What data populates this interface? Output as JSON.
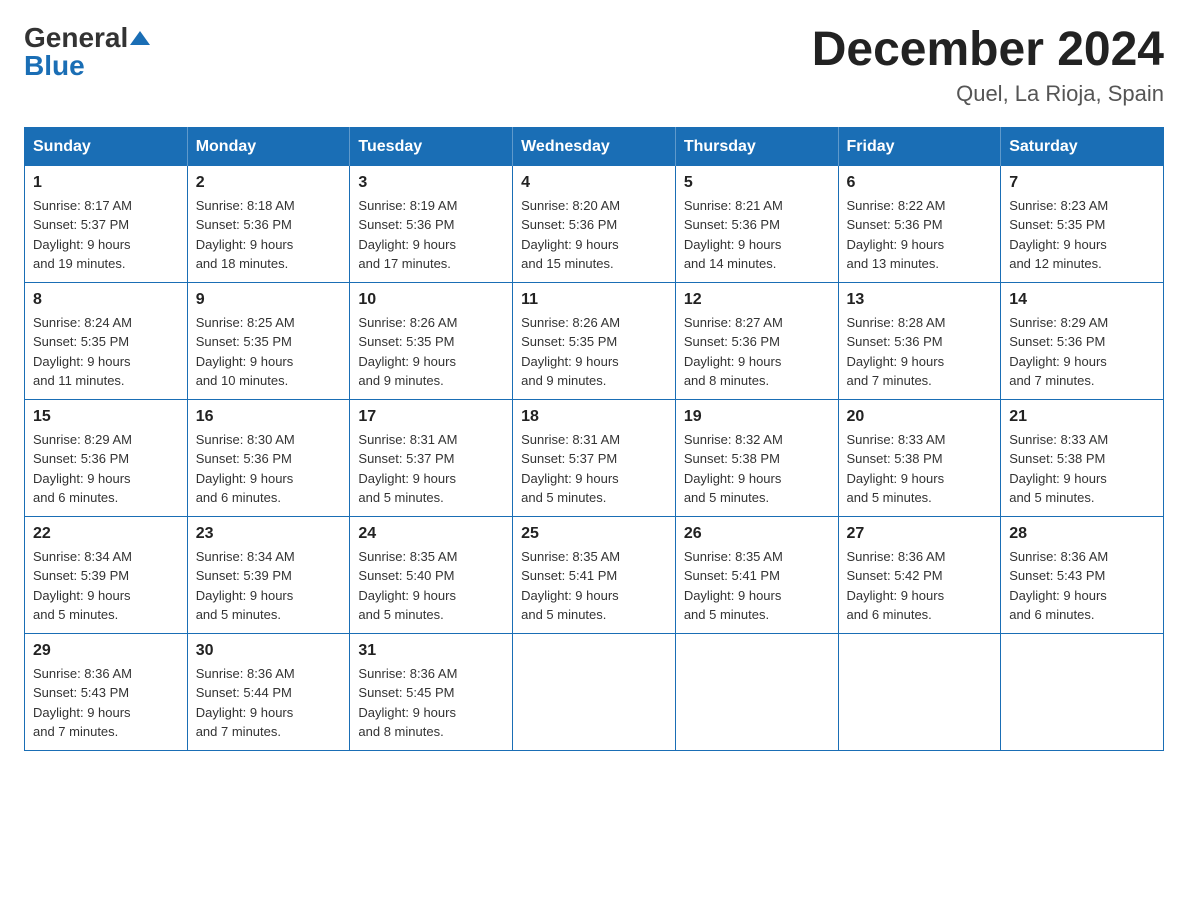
{
  "logo": {
    "general_text": "General",
    "blue_text": "Blue"
  },
  "title": {
    "month_year": "December 2024",
    "location": "Quel, La Rioja, Spain"
  },
  "days_of_week": [
    "Sunday",
    "Monday",
    "Tuesday",
    "Wednesday",
    "Thursday",
    "Friday",
    "Saturday"
  ],
  "weeks": [
    [
      {
        "day": "1",
        "sunrise": "8:17 AM",
        "sunset": "5:37 PM",
        "daylight": "9 hours and 19 minutes."
      },
      {
        "day": "2",
        "sunrise": "8:18 AM",
        "sunset": "5:36 PM",
        "daylight": "9 hours and 18 minutes."
      },
      {
        "day": "3",
        "sunrise": "8:19 AM",
        "sunset": "5:36 PM",
        "daylight": "9 hours and 17 minutes."
      },
      {
        "day": "4",
        "sunrise": "8:20 AM",
        "sunset": "5:36 PM",
        "daylight": "9 hours and 15 minutes."
      },
      {
        "day": "5",
        "sunrise": "8:21 AM",
        "sunset": "5:36 PM",
        "daylight": "9 hours and 14 minutes."
      },
      {
        "day": "6",
        "sunrise": "8:22 AM",
        "sunset": "5:36 PM",
        "daylight": "9 hours and 13 minutes."
      },
      {
        "day": "7",
        "sunrise": "8:23 AM",
        "sunset": "5:35 PM",
        "daylight": "9 hours and 12 minutes."
      }
    ],
    [
      {
        "day": "8",
        "sunrise": "8:24 AM",
        "sunset": "5:35 PM",
        "daylight": "9 hours and 11 minutes."
      },
      {
        "day": "9",
        "sunrise": "8:25 AM",
        "sunset": "5:35 PM",
        "daylight": "9 hours and 10 minutes."
      },
      {
        "day": "10",
        "sunrise": "8:26 AM",
        "sunset": "5:35 PM",
        "daylight": "9 hours and 9 minutes."
      },
      {
        "day": "11",
        "sunrise": "8:26 AM",
        "sunset": "5:35 PM",
        "daylight": "9 hours and 9 minutes."
      },
      {
        "day": "12",
        "sunrise": "8:27 AM",
        "sunset": "5:36 PM",
        "daylight": "9 hours and 8 minutes."
      },
      {
        "day": "13",
        "sunrise": "8:28 AM",
        "sunset": "5:36 PM",
        "daylight": "9 hours and 7 minutes."
      },
      {
        "day": "14",
        "sunrise": "8:29 AM",
        "sunset": "5:36 PM",
        "daylight": "9 hours and 7 minutes."
      }
    ],
    [
      {
        "day": "15",
        "sunrise": "8:29 AM",
        "sunset": "5:36 PM",
        "daylight": "9 hours and 6 minutes."
      },
      {
        "day": "16",
        "sunrise": "8:30 AM",
        "sunset": "5:36 PM",
        "daylight": "9 hours and 6 minutes."
      },
      {
        "day": "17",
        "sunrise": "8:31 AM",
        "sunset": "5:37 PM",
        "daylight": "9 hours and 5 minutes."
      },
      {
        "day": "18",
        "sunrise": "8:31 AM",
        "sunset": "5:37 PM",
        "daylight": "9 hours and 5 minutes."
      },
      {
        "day": "19",
        "sunrise": "8:32 AM",
        "sunset": "5:38 PM",
        "daylight": "9 hours and 5 minutes."
      },
      {
        "day": "20",
        "sunrise": "8:33 AM",
        "sunset": "5:38 PM",
        "daylight": "9 hours and 5 minutes."
      },
      {
        "day": "21",
        "sunrise": "8:33 AM",
        "sunset": "5:38 PM",
        "daylight": "9 hours and 5 minutes."
      }
    ],
    [
      {
        "day": "22",
        "sunrise": "8:34 AM",
        "sunset": "5:39 PM",
        "daylight": "9 hours and 5 minutes."
      },
      {
        "day": "23",
        "sunrise": "8:34 AM",
        "sunset": "5:39 PM",
        "daylight": "9 hours and 5 minutes."
      },
      {
        "day": "24",
        "sunrise": "8:35 AM",
        "sunset": "5:40 PM",
        "daylight": "9 hours and 5 minutes."
      },
      {
        "day": "25",
        "sunrise": "8:35 AM",
        "sunset": "5:41 PM",
        "daylight": "9 hours and 5 minutes."
      },
      {
        "day": "26",
        "sunrise": "8:35 AM",
        "sunset": "5:41 PM",
        "daylight": "9 hours and 5 minutes."
      },
      {
        "day": "27",
        "sunrise": "8:36 AM",
        "sunset": "5:42 PM",
        "daylight": "9 hours and 6 minutes."
      },
      {
        "day": "28",
        "sunrise": "8:36 AM",
        "sunset": "5:43 PM",
        "daylight": "9 hours and 6 minutes."
      }
    ],
    [
      {
        "day": "29",
        "sunrise": "8:36 AM",
        "sunset": "5:43 PM",
        "daylight": "9 hours and 7 minutes."
      },
      {
        "day": "30",
        "sunrise": "8:36 AM",
        "sunset": "5:44 PM",
        "daylight": "9 hours and 7 minutes."
      },
      {
        "day": "31",
        "sunrise": "8:36 AM",
        "sunset": "5:45 PM",
        "daylight": "9 hours and 8 minutes."
      },
      null,
      null,
      null,
      null
    ]
  ],
  "labels": {
    "sunrise": "Sunrise:",
    "sunset": "Sunset:",
    "daylight": "Daylight:"
  }
}
